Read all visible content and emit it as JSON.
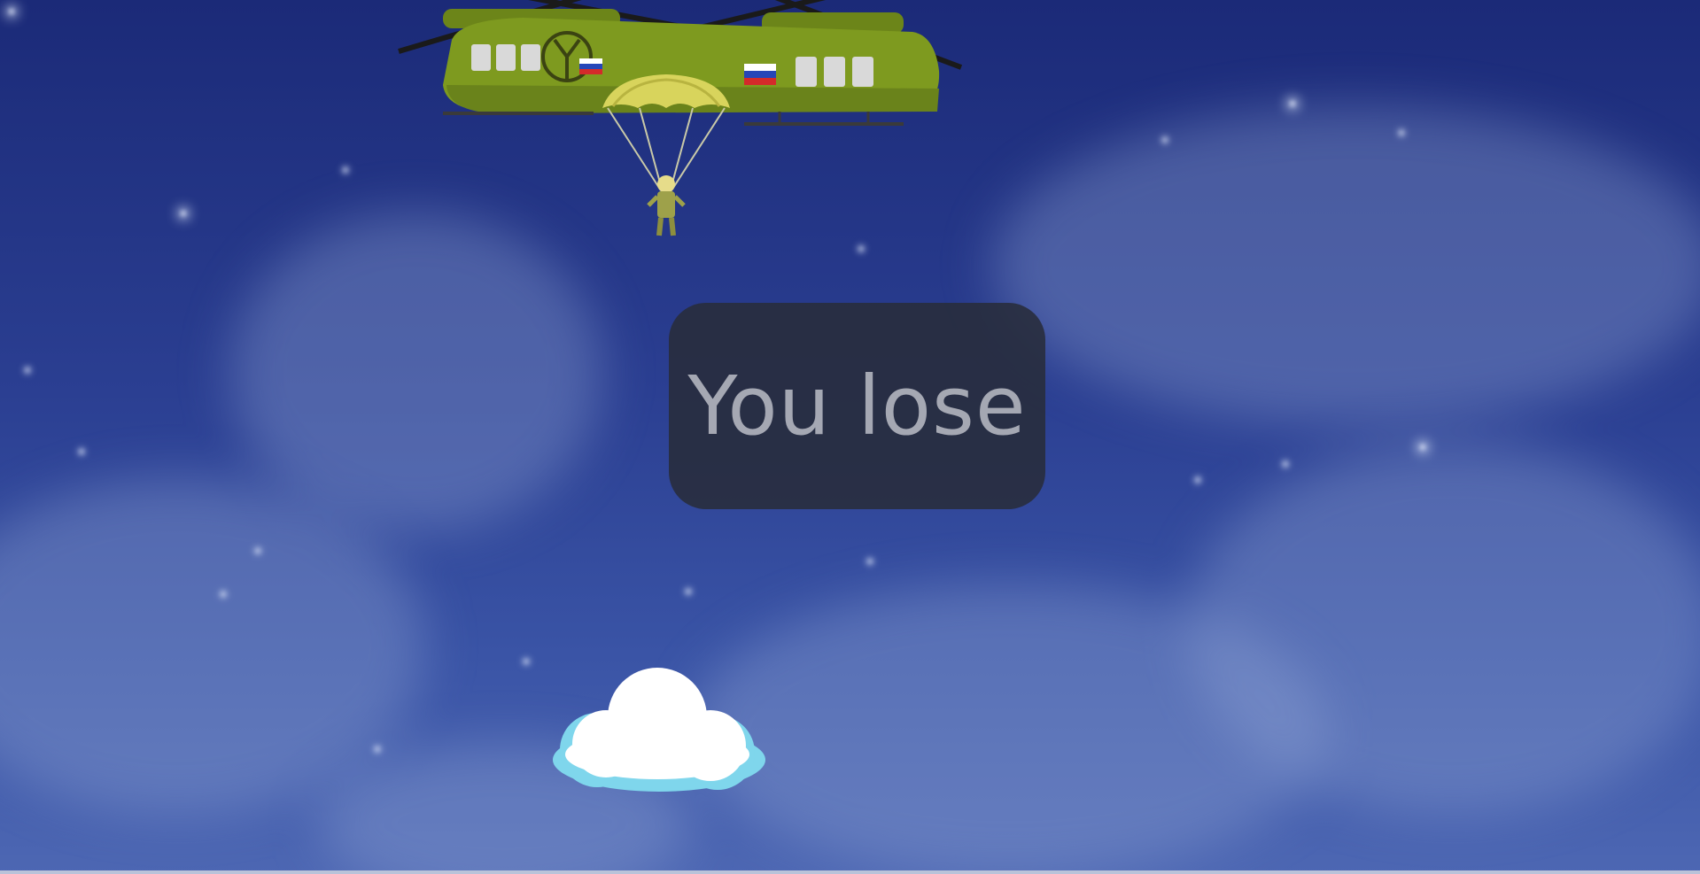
{
  "game": {
    "status_message": "You lose"
  },
  "colors": {
    "sky_top": "#1b2a78",
    "sky_bottom": "#4d67b3",
    "overlay_bg": "#282c3a",
    "overlay_text": "#a5a8b3",
    "helicopter_body": "#7e9a1f",
    "parachute": "#d8d45c",
    "cloud_white": "#ffffff",
    "cloud_cyan": "#7fd6ec"
  },
  "icons": {
    "helicopter": "helicopter-icon",
    "parachutist": "parachutist-icon",
    "cloud": "cloud-icon",
    "flag": "flag-icon"
  }
}
